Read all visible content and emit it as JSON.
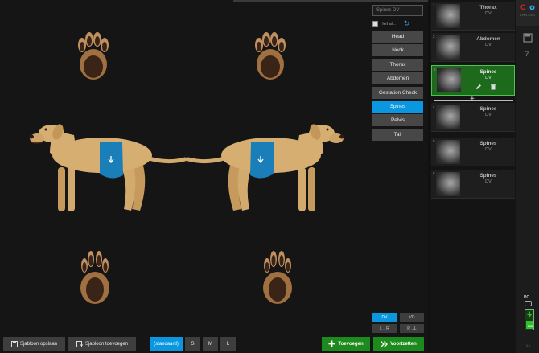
{
  "body_part_field": {
    "value": "Spines DV"
  },
  "repeat": {
    "label": "Herhal...",
    "checked": false
  },
  "body_parts": [
    {
      "label": "Head",
      "active": false
    },
    {
      "label": "Neck",
      "active": false
    },
    {
      "label": "Thorax",
      "active": false
    },
    {
      "label": "Abdomen",
      "active": false
    },
    {
      "label": "Gestation Check",
      "active": false
    },
    {
      "label": "Spines",
      "active": true
    },
    {
      "label": "Pelvis",
      "active": false
    },
    {
      "label": "Tail",
      "active": false
    }
  ],
  "projections": {
    "dv": "DV",
    "vd": "VD",
    "l_r": "L→R",
    "r_l": "R→L",
    "selected": "DV"
  },
  "toolbar": {
    "save_template": "Sjabloon opslaan",
    "add_template": "Sjabloon toevoegen",
    "size_standard": "(standaard)",
    "size_s": "S",
    "size_m": "M",
    "size_l": "L",
    "add": "Toevoegen",
    "continue": "Voortzetten"
  },
  "thumbnails": [
    {
      "index": "1",
      "name": "Thorax",
      "projection": "DV",
      "selected": false
    },
    {
      "index": "2",
      "name": "Abdomen",
      "projection": "DV",
      "selected": false
    },
    {
      "index": "3",
      "name": "Spines",
      "projection": "DV",
      "selected": true
    },
    {
      "index": "4",
      "name": "Spines",
      "projection": "DV",
      "selected": false
    },
    {
      "index": "5",
      "name": "Spines",
      "projection": "DV",
      "selected": false
    },
    {
      "index": "6",
      "name": "Spines",
      "projection": "DV",
      "selected": false
    }
  ],
  "rail": {
    "logo": "C",
    "logo_sub": "LH01 • D41",
    "pc_label": "PC",
    "battery": "100",
    "version": "6.0"
  },
  "colors": {
    "accent_blue": "#0a97e0",
    "green": "#1c8a1c",
    "highlight_body": "#1a7fb8"
  }
}
